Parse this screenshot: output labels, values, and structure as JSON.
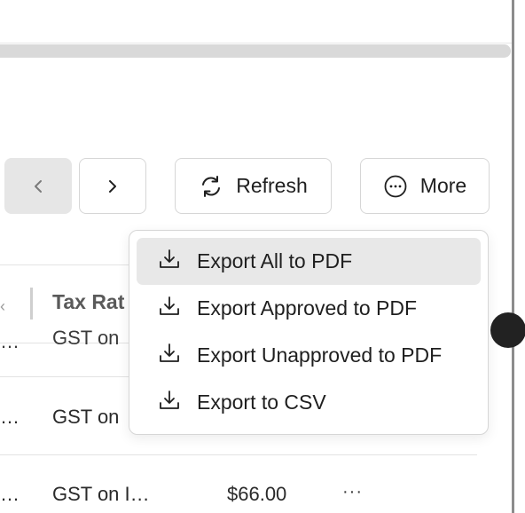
{
  "toolbar": {
    "refresh_label": "Refresh",
    "more_label": "More",
    "prev_icon": "chevron-left-icon",
    "next_icon": "chevron-right-icon"
  },
  "export_menu": {
    "items": [
      {
        "label": "Export All to PDF",
        "icon": "download-icon"
      },
      {
        "label": "Export Approved to PDF",
        "icon": "download-icon"
      },
      {
        "label": "Export Unapproved to PDF",
        "icon": "download-icon"
      },
      {
        "label": "Export to CSV",
        "icon": "download-icon"
      }
    ]
  },
  "table": {
    "header_tax_rate": "Tax Rat",
    "rows": [
      {
        "left": "…",
        "tax": "GST on"
      },
      {
        "left": "…",
        "tax": "GST on"
      },
      {
        "left": "…",
        "tax": "GST on I…",
        "amount": "$66.00",
        "menu": "···"
      }
    ]
  },
  "colors": {
    "border": "#d6d6d6",
    "active_bg": "#e8e8e8",
    "disabled_bg": "#e6e6e6"
  }
}
